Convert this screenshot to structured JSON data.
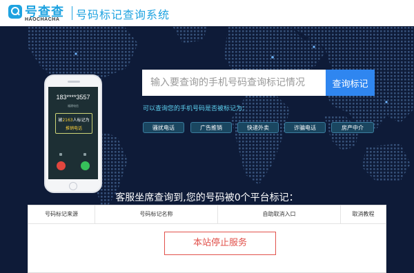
{
  "header": {
    "logo_cn": "号查查",
    "logo_en": "HAOCHACHA",
    "system_title": "号码标记查询系统"
  },
  "phone": {
    "number": "183****3557",
    "subtext": "福建电信",
    "mark_prefix": "被",
    "mark_count": "2163",
    "mark_suffix": "人标记为",
    "mark_tag": "推销电话"
  },
  "search": {
    "placeholder": "输入要查询的手机号码查询标记情况",
    "button_label": "查询标记",
    "hint": "可以查询您的手机号码是否被标记为："
  },
  "tags": [
    "骚扰电话",
    "广告推销",
    "快递外卖",
    "诈骗电话",
    "房产中介"
  ],
  "result": {
    "title": "客服坐席查询到,您的号码被0个平台标记：",
    "columns": [
      "号码标记来源",
      "号码标记名称",
      "自助取消入口",
      "取消教程"
    ],
    "notice": "本站停止服务"
  },
  "colors": {
    "brand": "#1fa3e0",
    "button": "#2f86f0",
    "hint": "#5ed3f2",
    "notice": "#e1504a",
    "background": "#0e1b38"
  }
}
